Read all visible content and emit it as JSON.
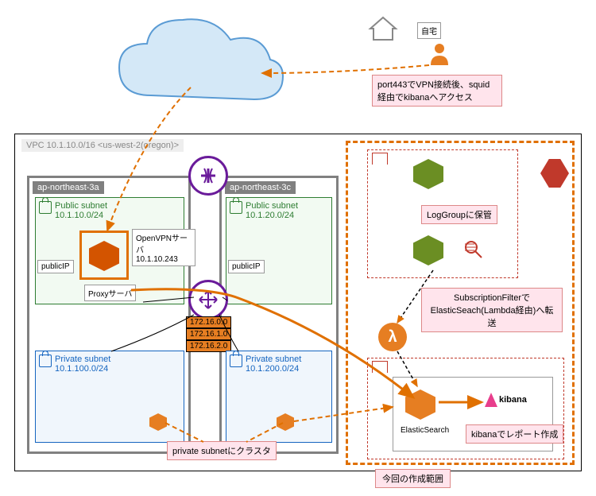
{
  "home_label": "自宅",
  "callout_vpn": "port443でVPN接続後、squid経由でkibanaへアクセス",
  "vpc": {
    "label": "VPC 10.1.10.0/16 <us-west-2(oregon)>"
  },
  "az": {
    "a": "ap-northeast-3a",
    "c": "ap-northeast-3c"
  },
  "subnets": {
    "pub_a": {
      "title": "Public subnet",
      "cidr": "10.1.10.0/24",
      "ip_lbl": "publicIP"
    },
    "pub_c": {
      "title": "Public subnet",
      "cidr": "10.1.20.0/24",
      "ip_lbl": "publicIP"
    },
    "priv_a": {
      "title": "Private subnet",
      "cidr": "10.1.100.0/24"
    },
    "priv_c": {
      "title": "Private subnet",
      "cidr": "10.1.200.0/24"
    }
  },
  "openvpn": {
    "title": "OpenVPNサーバ",
    "ip": "10.1.10.243"
  },
  "proxy_label": "Proxyサーバ",
  "route_cidrs": [
    "172.16.0.0",
    "172.16.1.0",
    "172.16.2.0"
  ],
  "loggroup_label": "LogGroupに保管",
  "subfilter_label": "SubscriptionFilterでElasticSeach(Lambda経由)へ転送",
  "es_label": "ElasticSearch",
  "kibana_label": "kibana",
  "kibana_report": "kibanaでレポート作成",
  "private_cluster": "private subnetにクラスタ",
  "scope_label": "今回の作成範囲"
}
